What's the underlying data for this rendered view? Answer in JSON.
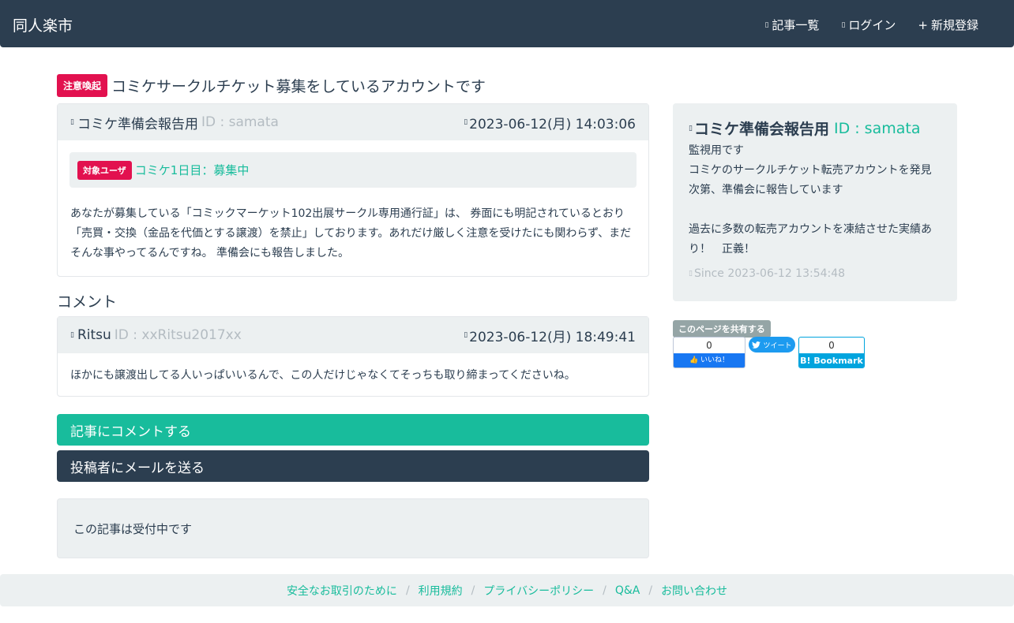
{
  "navbar": {
    "brand": "同人楽市",
    "links": [
      {
        "icon": "list-icon",
        "glyph": "▯",
        "label": "記事一覧"
      },
      {
        "icon": "login-icon",
        "glyph": "▯",
        "label": "ログイン"
      },
      {
        "icon": "plus-icon",
        "glyph": "+",
        "label": "新規登録"
      }
    ]
  },
  "article": {
    "badge": "注意喚起",
    "title": "コミケサークルチケット募集をしているアカウントです",
    "author_name": "コミケ準備会報告用",
    "author_id": "ID : samata",
    "date": "2023-06-12(月) 14:03:06",
    "target_badge": "対象ユーザ",
    "target_label": "コミケ1日目：募集中",
    "body": "あなたが募集している「コミックマーケット102出展サークル専用通行証」は、 券面にも明記されているとおり「売買・交換（金品を代価とする譲渡）を禁止」しております。あれだけ厳しく注意を受けたにも関わらず、まだそんな事やってるんですね。 準備会にも報告しました。"
  },
  "comments": {
    "section_title": "コメント",
    "items": [
      {
        "name": "Ritsu",
        "user_id": "ID : xxRitsu2017xx",
        "date": "2023-06-12(月) 18:49:41",
        "text": "ほかにも譲渡出してる人いっぱいいるんで、この人だけじゃなくてそっちも取り締まってくださいね。"
      }
    ]
  },
  "actions": {
    "comment_button": "記事にコメントする",
    "mail_button": "投稿者にメールを送る",
    "status": "この記事は受付中です"
  },
  "profile": {
    "name": "コミケ準備会報告用",
    "user_id": "ID : samata",
    "bio": "監視用です\nコミケのサークルチケット転売アカウントを発見次第、準備会に報告しています\n\n過去に多数の転売アカウントを凍結させた実績あり！　正義！",
    "since": "Since 2023-06-12 13:54:48"
  },
  "share": {
    "label": "このページを共有する",
    "facebook_count": "0",
    "facebook_label": "いいね！",
    "twitter_label": "ツイート",
    "hatena_count": "0",
    "hatena_label": "B! Bookmark"
  },
  "footer": {
    "links": [
      "安全なお取引のために",
      "利用規約",
      "プライバシーポリシー",
      "Q&A",
      "お問い合わせ"
    ]
  },
  "colors": {
    "primary": "#2c3e50",
    "success": "#18bc9c",
    "danger": "#e2114f",
    "light": "#ecf0f1",
    "muted": "#b4bcc2"
  }
}
